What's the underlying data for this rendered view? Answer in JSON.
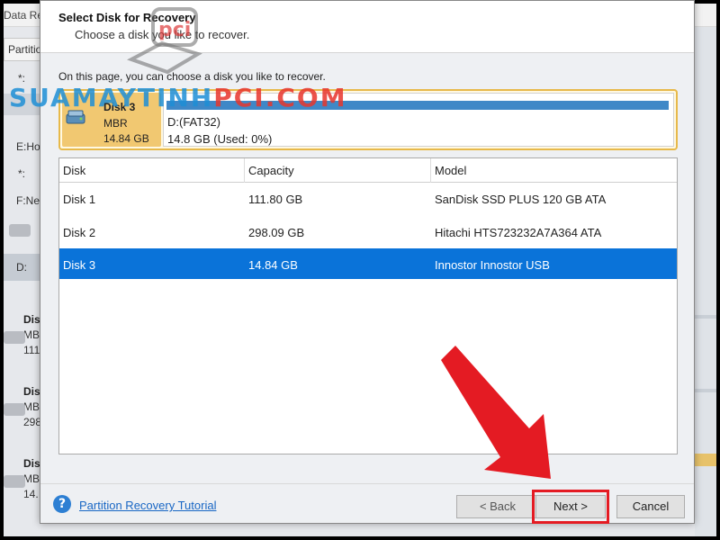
{
  "background_app": {
    "title_fragment": "Data Re",
    "tab_fragment": "Partitio",
    "rows": [
      {
        "label": "*:"
      },
      {
        "label": "E:Ho"
      },
      {
        "label": "*:"
      },
      {
        "label": "F:Ne"
      },
      {
        "label": "D:"
      }
    ],
    "disks": [
      {
        "name": "Disk",
        "scheme": "MBR",
        "size": "111"
      },
      {
        "name": "Disk",
        "scheme": "MBR",
        "size": "298"
      },
      {
        "name": "Disk",
        "scheme": "MBR",
        "size": "14."
      }
    ]
  },
  "dialog": {
    "title": "Select Disk for Recovery",
    "subtitle": "Choose a disk you like to recover.",
    "intro": "On this page, you can choose a disk you like to recover.",
    "selected_disk": {
      "name": "Disk 3",
      "scheme": "MBR",
      "size": "14.84 GB",
      "partition_name": "D:(FAT32)",
      "partition_info": "14.8 GB (Used: 0%)",
      "used_fraction": 1.0
    },
    "table": {
      "headers": [
        "Disk",
        "Capacity",
        "Model"
      ],
      "rows": [
        {
          "disk": "Disk 1",
          "capacity": "111.80 GB",
          "model": "SanDisk SSD PLUS 120 GB ATA"
        },
        {
          "disk": "Disk 2",
          "capacity": "298.09 GB",
          "model": "Hitachi HTS723232A7A364 ATA"
        },
        {
          "disk": "Disk 3",
          "capacity": "14.84 GB",
          "model": "Innostor Innostor USB"
        }
      ],
      "selected_index": 2
    },
    "footer": {
      "help_label": "Partition Recovery Tutorial",
      "back_label": "< Back",
      "next_label": "Next >",
      "cancel_label": "Cancel"
    }
  },
  "watermark": {
    "text_main": "SUAMAYTINH",
    "text_accent": "PCI.COM",
    "logo_text": "pci"
  },
  "colors": {
    "accent_blue": "#0a73d9",
    "card_gold": "#f1c871",
    "highlight_red": "#e41b23",
    "link_blue": "#1866c4"
  }
}
